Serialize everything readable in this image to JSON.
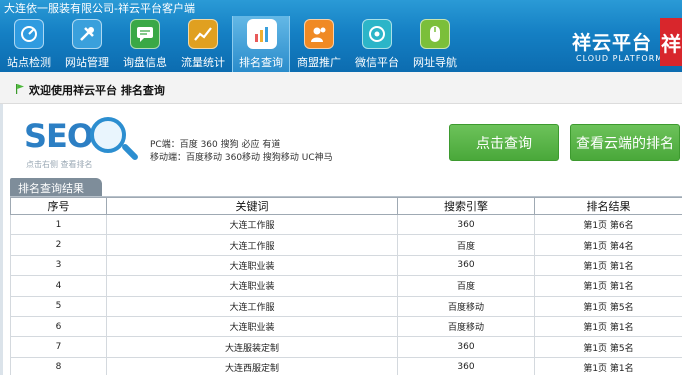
{
  "window": {
    "title": "大连依一服装有限公司-祥云平台客户端"
  },
  "toolbar": {
    "items": [
      {
        "label": "站点检测",
        "icon": "site-check-icon",
        "color": "#2f9be0"
      },
      {
        "label": "网站管理",
        "icon": "tools-icon",
        "color": "#3aa0dc"
      },
      {
        "label": "询盘信息",
        "icon": "chat-icon",
        "color": "#3aa846"
      },
      {
        "label": "流量统计",
        "icon": "trend-icon",
        "color": "#e0a020"
      },
      {
        "label": "排名查询",
        "icon": "bar-chart-icon",
        "color": "#e86a8a"
      },
      {
        "label": "商盟推广",
        "icon": "people-icon",
        "color": "#f08a24"
      },
      {
        "label": "微信平台",
        "icon": "wechat-icon",
        "color": "#2cb5c8"
      },
      {
        "label": "网址导航",
        "icon": "mouse-icon",
        "color": "#7bbf3a"
      }
    ],
    "active_index": 4
  },
  "brand": {
    "name": "祥云平台",
    "sub": "CLOUD PLATFORM",
    "mark": "祥"
  },
  "welcome": {
    "text": "欢迎使用祥云平台   排名查询"
  },
  "seo": {
    "logo_text": "SEO",
    "hint": "点击右侧 查看排名",
    "pc_engines": "PC端：百度 360 搜狗 必应 有道",
    "mobile_engines": "移动端：百度移动 360移动 搜狗移动 UC神马"
  },
  "buttons": {
    "query": "点击查询",
    "cloud_rank": "查看云端的排名"
  },
  "results": {
    "tab_label": "排名查询结果",
    "columns": [
      "序号",
      "关键词",
      "搜索引擎",
      "排名结果"
    ],
    "rows": [
      [
        "1",
        "大连工作服",
        "360",
        "第1页 第6名"
      ],
      [
        "2",
        "大连工作服",
        "百度",
        "第1页 第4名"
      ],
      [
        "3",
        "大连职业装",
        "360",
        "第1页 第1名"
      ],
      [
        "4",
        "大连职业装",
        "百度",
        "第1页 第1名"
      ],
      [
        "5",
        "大连工作服",
        "百度移动",
        "第1页 第5名"
      ],
      [
        "6",
        "大连职业装",
        "百度移动",
        "第1页 第1名"
      ],
      [
        "7",
        "大连服装定制",
        "360",
        "第1页 第5名"
      ],
      [
        "8",
        "大连西服定制",
        "360",
        "第1页 第1名"
      ]
    ]
  }
}
